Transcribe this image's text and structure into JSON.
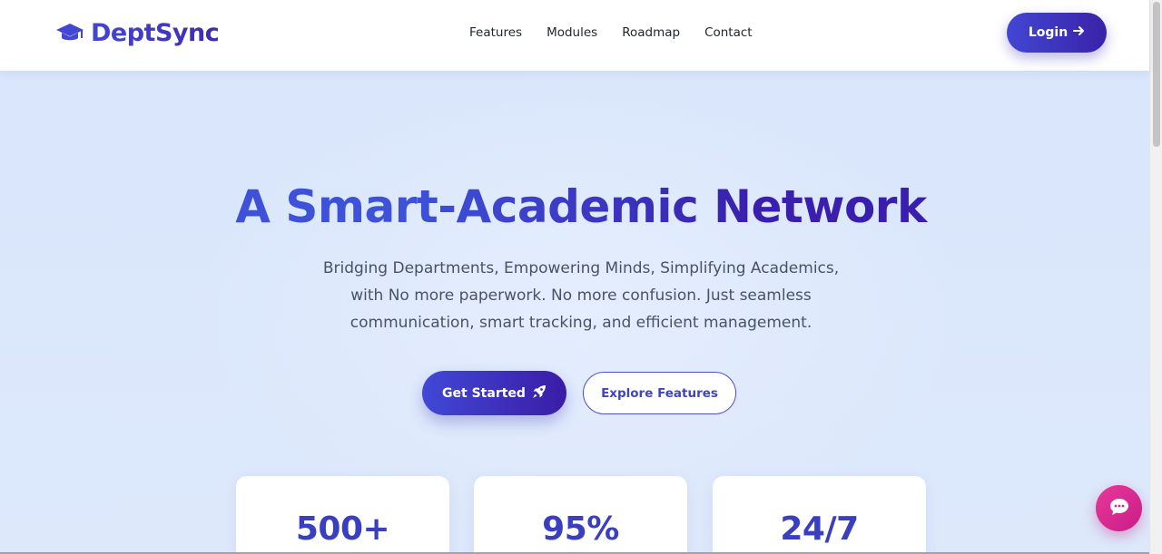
{
  "brand": {
    "name": "DeptSync",
    "icon": "graduation-cap-icon"
  },
  "nav": {
    "items": [
      "Features",
      "Modules",
      "Roadmap",
      "Contact"
    ]
  },
  "header": {
    "login_label": "Login",
    "login_icon": "arrow-right-icon"
  },
  "hero": {
    "title": "A Smart-Academic Network",
    "subtitle_lines": [
      "Bridging Departments, Empowering Minds, Simplifying Academics,",
      "with No more paperwork. No more confusion. Just seamless",
      "communication, smart tracking, and efficient management."
    ],
    "primary_cta": "Get Started",
    "primary_cta_icon": "rocket-icon",
    "secondary_cta": "Explore Features"
  },
  "stats": [
    {
      "value": "500+"
    },
    {
      "value": "95%"
    },
    {
      "value": "24/7"
    }
  ],
  "chat": {
    "icon": "chat-bubble-icon"
  },
  "colors": {
    "accent": "#4247d3",
    "accent_dark": "#3a22a8",
    "background": "#dbe7fb",
    "chat": "#e0308f"
  }
}
